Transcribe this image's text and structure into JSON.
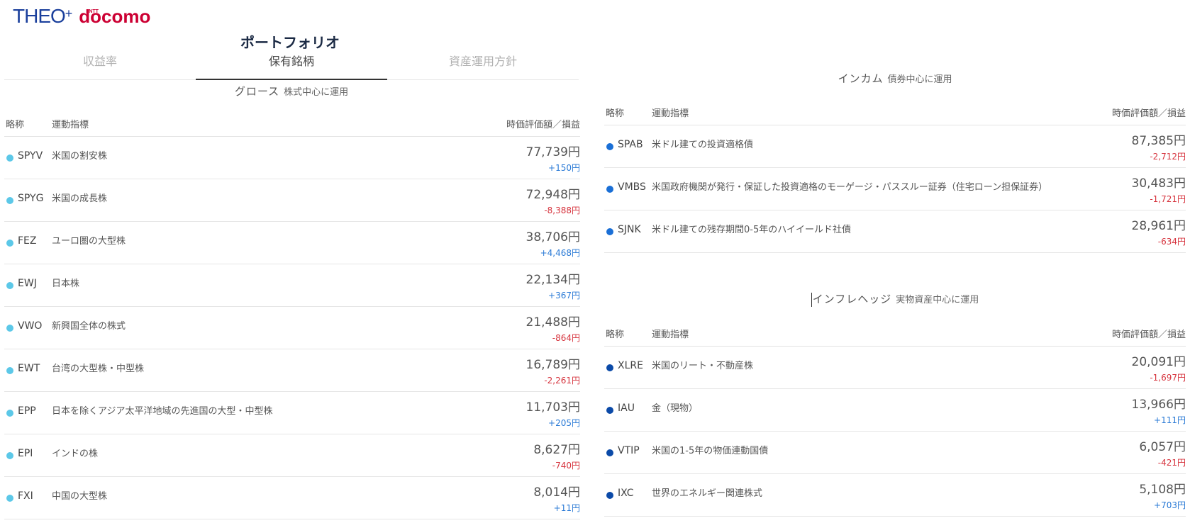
{
  "brand": {
    "theo": "THEO",
    "plus": "+",
    "ntt": "NTT",
    "docomo": "docomo"
  },
  "page": {
    "title": "ポートフォリオ"
  },
  "tabs": [
    {
      "label": "収益率",
      "active": false
    },
    {
      "label": "保有銘柄",
      "active": true
    },
    {
      "label": "資産運用方針",
      "active": false
    }
  ],
  "columns": {
    "abbr": "略称",
    "index": "運動指標",
    "value": "時価評価額／損益"
  },
  "colors": {
    "growth": "#5cc8e8",
    "income": "#1a6fd6",
    "inflation": "#0b4aa8",
    "positive": "#2a7ad6",
    "negative": "#d6333d"
  },
  "growth": {
    "title": "グロース",
    "subtitle": "株式中心に運用",
    "rows": [
      {
        "ticker": "SPYV",
        "index": "米国の割安株",
        "amount": "77,739円",
        "pl": "+150円",
        "sign": "pos"
      },
      {
        "ticker": "SPYG",
        "index": "米国の成長株",
        "amount": "72,948円",
        "pl": "-8,388円",
        "sign": "neg"
      },
      {
        "ticker": "FEZ",
        "index": "ユーロ圏の大型株",
        "amount": "38,706円",
        "pl": "+4,468円",
        "sign": "pos"
      },
      {
        "ticker": "EWJ",
        "index": "日本株",
        "amount": "22,134円",
        "pl": "+367円",
        "sign": "pos"
      },
      {
        "ticker": "VWO",
        "index": "新興国全体の株式",
        "amount": "21,488円",
        "pl": "-864円",
        "sign": "neg"
      },
      {
        "ticker": "EWT",
        "index": "台湾の大型株・中型株",
        "amount": "16,789円",
        "pl": "-2,261円",
        "sign": "neg"
      },
      {
        "ticker": "EPP",
        "index": "日本を除くアジア太平洋地域の先進国の大型・中型株",
        "amount": "11,703円",
        "pl": "+205円",
        "sign": "pos"
      },
      {
        "ticker": "EPI",
        "index": "インドの株",
        "amount": "8,627円",
        "pl": "-740円",
        "sign": "neg"
      },
      {
        "ticker": "FXI",
        "index": "中国の大型株",
        "amount": "8,014円",
        "pl": "+11円",
        "sign": "pos"
      }
    ]
  },
  "income": {
    "title": "インカム",
    "subtitle": "債券中心に運用",
    "rows": [
      {
        "ticker": "SPAB",
        "index": "米ドル建ての投資適格債",
        "amount": "87,385円",
        "pl": "-2,712円",
        "sign": "neg"
      },
      {
        "ticker": "VMBS",
        "index": "米国政府機関が発行・保証した投資適格のモーゲージ・パススルー証券（住宅ローン担保証券）",
        "amount": "30,483円",
        "pl": "-1,721円",
        "sign": "neg"
      },
      {
        "ticker": "SJNK",
        "index": "米ドル建ての残存期間0-5年のハイイールド社債",
        "amount": "28,961円",
        "pl": "-634円",
        "sign": "neg"
      }
    ]
  },
  "inflation": {
    "title": "インフレヘッジ",
    "subtitle": "実物資産中心に運用",
    "rows": [
      {
        "ticker": "XLRE",
        "index": "米国のリート・不動産株",
        "amount": "20,091円",
        "pl": "-1,697円",
        "sign": "neg"
      },
      {
        "ticker": "IAU",
        "index": "金（現物）",
        "amount": "13,966円",
        "pl": "+111円",
        "sign": "pos"
      },
      {
        "ticker": "VTIP",
        "index": "米国の1-5年の物価連動国債",
        "amount": "6,057円",
        "pl": "-421円",
        "sign": "neg"
      },
      {
        "ticker": "IXC",
        "index": "世界のエネルギー関連株式",
        "amount": "5,108円",
        "pl": "+703円",
        "sign": "pos"
      }
    ]
  }
}
